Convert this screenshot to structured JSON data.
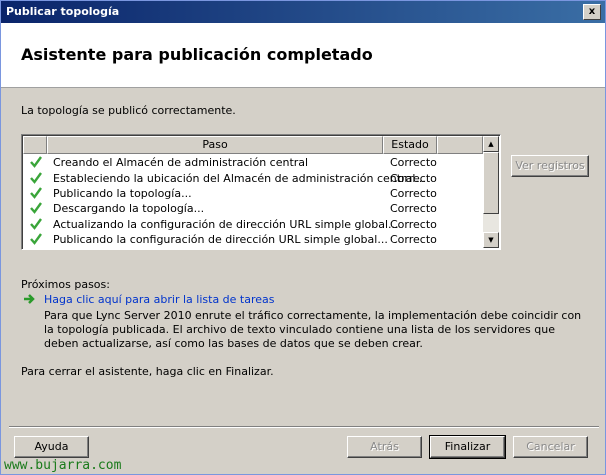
{
  "window": {
    "title": "Publicar topología",
    "close_glyph": "x"
  },
  "header": {
    "title": "Asistente para publicación completado"
  },
  "status_message": "La topología se publicó correctamente.",
  "steps_table": {
    "columns": [
      "Paso",
      "Estado"
    ],
    "rows": [
      {
        "paso": "Creando el Almacén de administración central",
        "estado": "Correcto"
      },
      {
        "paso": "Estableciendo la ubicación del Almacén de administración central...",
        "estado": "Correcto"
      },
      {
        "paso": "Publicando la topología...",
        "estado": "Correcto"
      },
      {
        "paso": "Descargando la topología...",
        "estado": "Correcto"
      },
      {
        "paso": "Actualizando la configuración de dirección URL simple global...",
        "estado": "Correcto"
      },
      {
        "paso": "Publicando la configuración de dirección URL simple global...",
        "estado": "Correcto"
      }
    ]
  },
  "view_logs_label": "Ver registros",
  "next_steps": {
    "label": "Próximos pasos:",
    "task_link": "Haga clic aquí para abrir la lista de tareas",
    "description": "Para que Lync Server 2010 enrute el tráfico correctamente, la implementación debe coincidir con la topología publicada. El archivo de texto vinculado contiene una lista de los servidores que deben actualizarse, así como las bases de datos que se deben crear."
  },
  "finish_instruction": "Para cerrar el asistente, haga clic en Finalizar.",
  "buttons": {
    "help": "Ayuda",
    "back": "Atrás",
    "finish": "Finalizar",
    "cancel": "Cancelar"
  },
  "watermark": "www.bujarra.com",
  "colors": {
    "titlebar": "#0a246a",
    "check": "#3aa53a",
    "link": "#0033cc",
    "watermark": "#1a7a1a"
  }
}
